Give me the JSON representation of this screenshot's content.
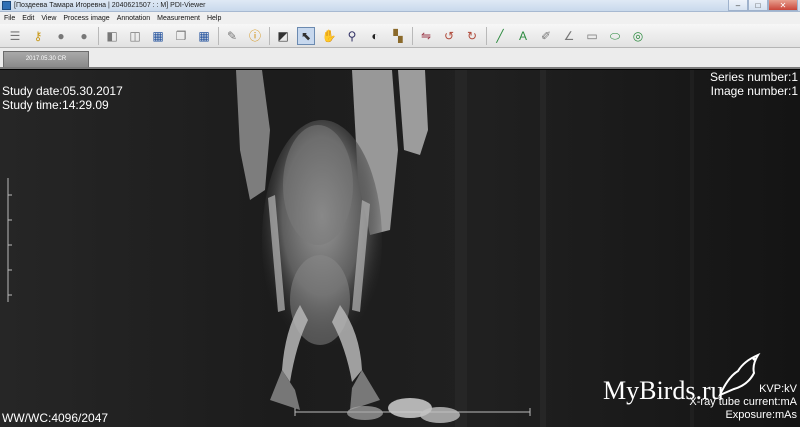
{
  "window": {
    "title": "[Поздеева Тамара Игоревна | 2040621507 :  : M] PDI-Viewer",
    "minimize": "–",
    "maximize": "□",
    "close": "✕"
  },
  "menu": [
    "File",
    "Edit",
    "View",
    "Process image",
    "Annotation",
    "Measurement",
    "Help"
  ],
  "toolbar": {
    "icons": [
      "list-icon",
      "key-icon",
      "user-icon",
      "users-icon",
      "layers-icon",
      "stack-icon",
      "grid-icon",
      "copy-icon",
      "grid-layout-icon",
      "edit-icon",
      "info-icon",
      "contrast-icon",
      "select-arrow-icon",
      "pan-hand-icon",
      "zoom-icon",
      "invert-icon",
      "tile-layout-icon",
      "flip-icon",
      "rotate-left-icon",
      "rotate-right-icon",
      "ruler-line-icon",
      "text-annotation-icon",
      "pen-icon",
      "angle-icon",
      "area-icon",
      "ellipse-icon",
      "circle-measure-icon"
    ],
    "active_icon": "select-arrow-icon"
  },
  "tab": {
    "label": "2017.05.30 CR"
  },
  "overlay": {
    "study_date": "Study date:05.30.2017",
    "study_time": "Study time:14:29.09",
    "series_number": "Series number:1",
    "image_number": "Image number:1",
    "ww_wc": "WW/WC:4096/2047",
    "kvp": "KVP:kV",
    "tube_current": "X-ray tube current:mA",
    "exposure": "Exposure:mAs"
  },
  "watermark": {
    "text": "MyBirds.ru"
  }
}
